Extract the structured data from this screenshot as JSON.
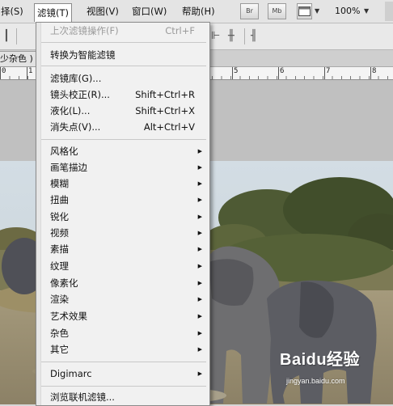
{
  "menubar": {
    "items": [
      {
        "label": "择(S)"
      },
      {
        "label": "滤镜(T)"
      },
      {
        "label": "视图(V)"
      },
      {
        "label": "窗口(W)"
      },
      {
        "label": "帮助(H)"
      }
    ],
    "bridge_label": "Br",
    "minibridge_label": "Mb",
    "zoom": "100%"
  },
  "document": {
    "tab_label": "少杂色 )"
  },
  "ruler": {
    "labels": [
      "0",
      "1",
      "5",
      "6",
      "7",
      "8"
    ]
  },
  "filter_menu": {
    "items": [
      {
        "label": "上次滤镜操作(F)",
        "shortcut": "Ctrl+F",
        "disabled": true
      },
      {
        "label": "转换为智能滤镜"
      },
      {
        "label": "滤镜库(G)..."
      },
      {
        "label": "镜头校正(R)...",
        "shortcut": "Shift+Ctrl+R"
      },
      {
        "label": "液化(L)...",
        "shortcut": "Shift+Ctrl+X"
      },
      {
        "label": "消失点(V)...",
        "shortcut": "Alt+Ctrl+V"
      },
      {
        "label": "风格化",
        "submenu": true
      },
      {
        "label": "画笔描边",
        "submenu": true
      },
      {
        "label": "模糊",
        "submenu": true
      },
      {
        "label": "扭曲",
        "submenu": true
      },
      {
        "label": "锐化",
        "submenu": true
      },
      {
        "label": "视频",
        "submenu": true
      },
      {
        "label": "素描",
        "submenu": true
      },
      {
        "label": "纹理",
        "submenu": true
      },
      {
        "label": "像素化",
        "submenu": true
      },
      {
        "label": "渲染",
        "submenu": true
      },
      {
        "label": "艺术效果",
        "submenu": true
      },
      {
        "label": "杂色",
        "submenu": true
      },
      {
        "label": "其它",
        "submenu": true
      },
      {
        "label": "Digimarc",
        "submenu": true
      },
      {
        "label": "浏览联机滤镜..."
      }
    ]
  },
  "watermark": {
    "text": "Baidu经验",
    "url": "jingyan.baidu.com"
  }
}
